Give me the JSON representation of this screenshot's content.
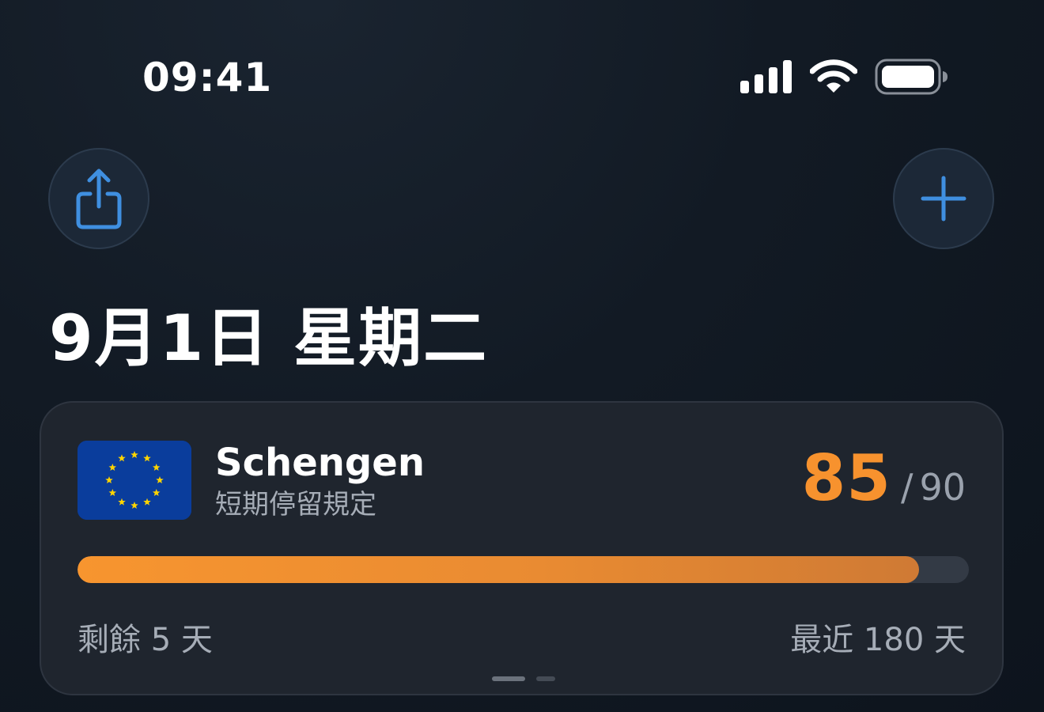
{
  "status_bar": {
    "time": "09:41"
  },
  "icons": {
    "share": "share-icon",
    "add": "plus-icon",
    "signal": "cellular-signal-icon",
    "wifi": "wifi-icon",
    "battery": "battery-icon"
  },
  "colors": {
    "accent_orange": "#f7922e",
    "accent_blue": "#3f8fe0",
    "eu_blue": "#0a3d9c",
    "eu_gold": "#ffd400"
  },
  "header": {
    "date_title": "9月1日 星期二"
  },
  "card": {
    "zone_name": "Schengen",
    "zone_subtitle": "短期停留規定",
    "days_used": "85",
    "separator": "/",
    "days_allowed": "90",
    "progress_fraction": 0.944,
    "remaining_label": "剩餘 5 天",
    "window_label": "最近 180 天",
    "page_count": 2,
    "active_page": 1
  }
}
